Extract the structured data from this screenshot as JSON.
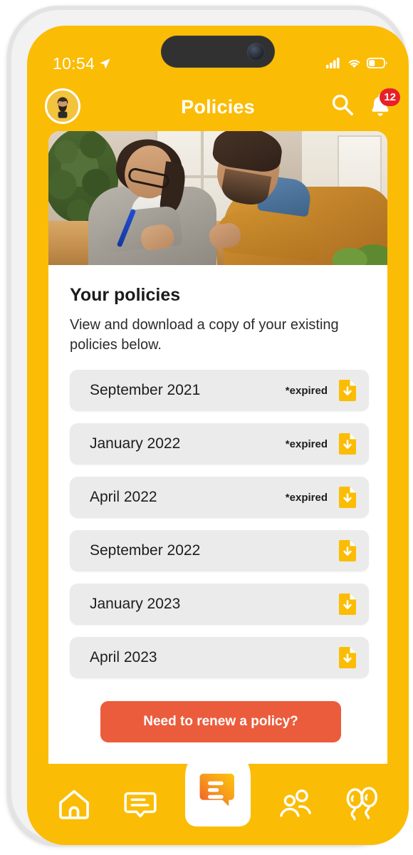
{
  "status_bar": {
    "time": "10:54",
    "location_icon": "location-arrow-icon",
    "signal_icon": "cellular-signal-icon",
    "wifi_icon": "wifi-icon",
    "battery_icon": "battery-icon",
    "battery_level_pct": 35
  },
  "header": {
    "title": "Policies",
    "avatar_name": "user-avatar",
    "search_icon": "search-icon",
    "bell_icon": "notification-bell-icon",
    "notification_count": "12"
  },
  "hero": {
    "alt": "Two people reviewing and signing a document at a table"
  },
  "main": {
    "title": "Your policies",
    "subtitle": "View and download a copy of your existing policies below.",
    "policies": [
      {
        "name": "September 2021",
        "status": "*expired",
        "download_icon": "download-document-icon"
      },
      {
        "name": "January 2022",
        "status": "*expired",
        "download_icon": "download-document-icon"
      },
      {
        "name": "April 2022",
        "status": "*expired",
        "download_icon": "download-document-icon"
      },
      {
        "name": "September 2022",
        "status": "",
        "download_icon": "download-document-icon"
      },
      {
        "name": "January 2023",
        "status": "",
        "download_icon": "download-document-icon"
      },
      {
        "name": "April 2023",
        "status": "",
        "download_icon": "download-document-icon"
      }
    ],
    "cta_label": "Need to renew a policy?"
  },
  "bottom_nav": {
    "items": [
      {
        "icon": "home-icon",
        "label": "Home"
      },
      {
        "icon": "chat-icon",
        "label": "Messages"
      },
      {
        "icon": "speech-bubble-e-icon",
        "label": "Assistant",
        "is_fab": true
      },
      {
        "icon": "people-icon",
        "label": "Community"
      },
      {
        "icon": "balloons-icon",
        "label": "Rewards"
      }
    ]
  },
  "colors": {
    "brand_yellow": "#FBBC05",
    "cta_orange": "#EB5C3C",
    "badge_red": "#E8202A",
    "row_gray": "#EBEBEB",
    "frame_gray": "#E3E3E3"
  }
}
